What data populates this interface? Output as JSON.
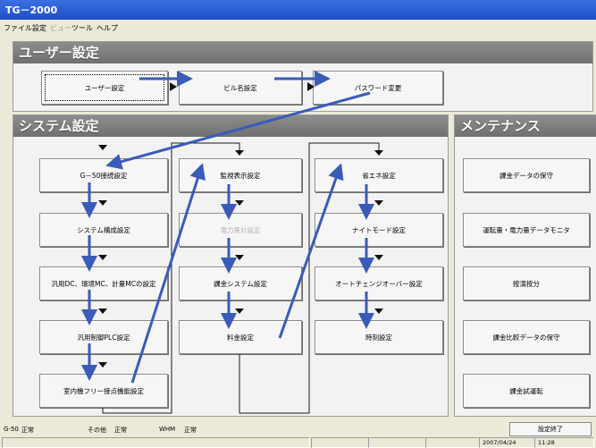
{
  "window": {
    "title": "TG－2000"
  },
  "menu": {
    "items": [
      "ファイル",
      "設定",
      "ビュー",
      "ツール",
      "ヘルプ"
    ]
  },
  "user_section": {
    "title": "ユーザー設定",
    "buttons": [
      "ユーザー設定",
      "ビル名設定",
      "パスワード変更"
    ]
  },
  "system_section": {
    "title": "システム設定",
    "col1": [
      "G－50接続設定",
      "システム構成設定",
      "汎用DC、環境MC、計量MCの設定",
      "汎用制御PLC設定",
      "室内機フリー接点機能設定"
    ],
    "col2": [
      "監視表示設定",
      "電力量計設定",
      "課金システム設定",
      "料金設定"
    ],
    "col3": [
      "省エネ設定",
      "ナイトモード設定",
      "オートチェンジオーバー設定",
      "時刻設定"
    ]
  },
  "maintenance_section": {
    "title": "メンテナンス",
    "buttons": [
      "課金データの保守",
      "運転量・電力量データモニタ",
      "按演按分",
      "課金比較データの保守",
      "課金試運転"
    ]
  },
  "status": {
    "g50_label": "G-50",
    "g50_value": "正常",
    "other_label": "その他",
    "other_value": "正常",
    "whm_label": "WHM",
    "whm_value": "正常",
    "exit_label": "設定終了",
    "date": "2007/04/24",
    "time": "11:28"
  },
  "colors": {
    "arrow": "#3a5bb8",
    "title_bar": "#2a5fd8",
    "section_header": "#7a7a7a"
  }
}
